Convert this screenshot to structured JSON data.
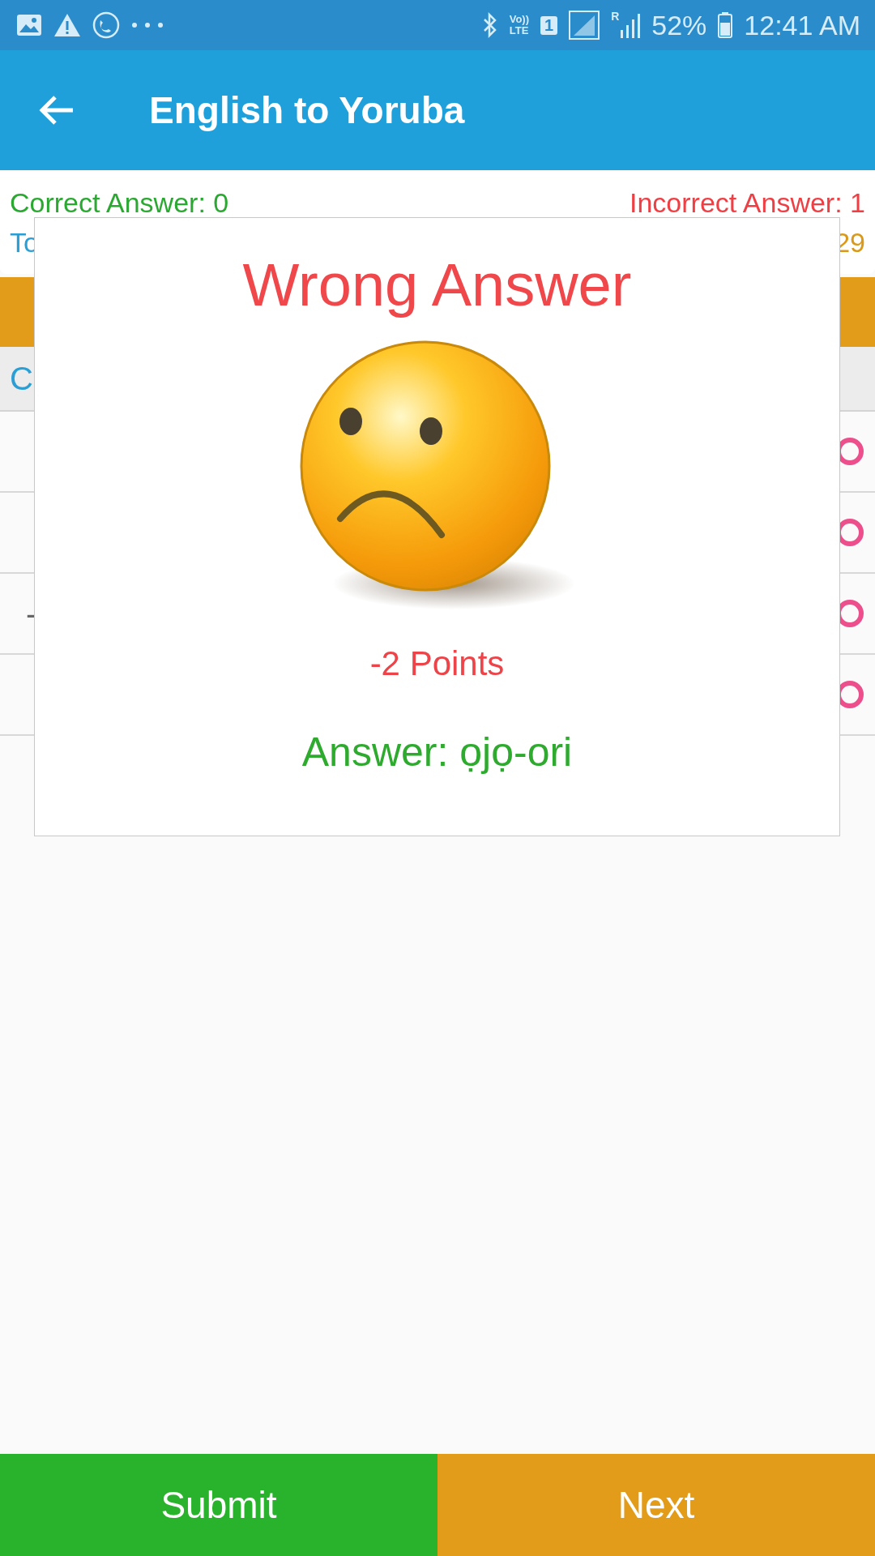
{
  "status_bar": {
    "volte": [
      "Vo))",
      "LTE"
    ],
    "sim": "1",
    "roaming": "R",
    "battery": "52%",
    "time": "12:41 AM"
  },
  "app_bar": {
    "title": "English to Yoruba"
  },
  "score_card": {
    "correct": "Correct Answer: 0",
    "incorrect": "Incorrect Answer: 1",
    "total_fragment": "To",
    "points_fragment": "29"
  },
  "instruction": {
    "fragment": "C"
  },
  "options": [
    {
      "selected": false
    },
    {
      "selected": false
    },
    {
      "fragment": "-",
      "selected": false
    },
    {
      "selected": false
    }
  ],
  "dialog": {
    "title": "Wrong Answer",
    "points": "-2 Points",
    "answer": "Answer: ọjọ-ori"
  },
  "buttons": [
    {
      "label": "Submit",
      "kind": "submit"
    },
    {
      "label": "Next",
      "kind": "next"
    }
  ]
}
